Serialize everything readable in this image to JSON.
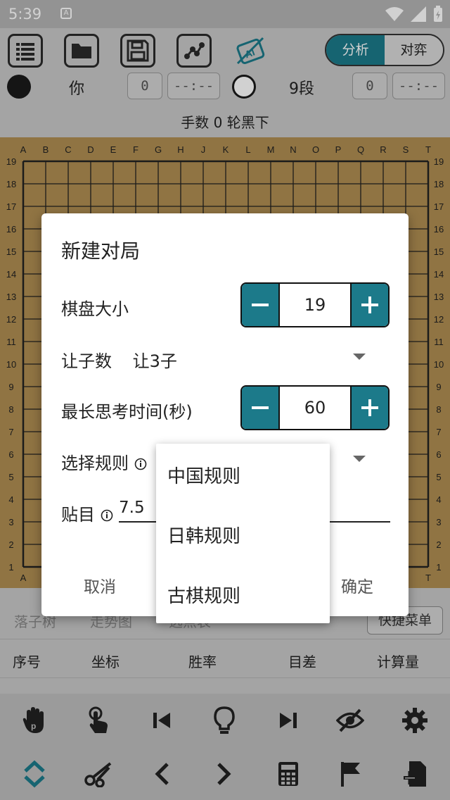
{
  "status": {
    "time": "5:39",
    "app_badge": "A"
  },
  "toolbar": {
    "icons": [
      "list-icon",
      "folder-icon",
      "save-icon",
      "graph-icon",
      "ai-off-icon"
    ],
    "mode_tabs": [
      {
        "label": "分析",
        "active": true
      },
      {
        "label": "对弈",
        "active": false
      }
    ]
  },
  "players": {
    "black": {
      "name": "你",
      "captures": "0",
      "time": "--:--"
    },
    "white": {
      "name": "9段",
      "captures": "0",
      "time": "--:--"
    }
  },
  "move_info": "手数 0  轮黑下",
  "board": {
    "columns": [
      "A",
      "B",
      "C",
      "D",
      "E",
      "F",
      "G",
      "H",
      "J",
      "K",
      "L",
      "M",
      "N",
      "O",
      "P",
      "Q",
      "R",
      "S",
      "T"
    ],
    "rows": [
      "19",
      "18",
      "17",
      "16",
      "15",
      "14",
      "13",
      "12",
      "11",
      "10",
      "9",
      "8",
      "7",
      "6",
      "5",
      "4",
      "3",
      "2",
      "1"
    ],
    "bg": "#b08e52"
  },
  "dialog": {
    "title": "新建对局",
    "board_size": {
      "label": "棋盘大小",
      "value": "19"
    },
    "handicap": {
      "label": "让子数",
      "value": "让3子"
    },
    "max_think": {
      "label": "最长思考时间(秒)",
      "value": "60"
    },
    "rules": {
      "label": "选择规则"
    },
    "komi": {
      "label": "贴目",
      "value": "7.5"
    },
    "cancel": "取消",
    "confirm": "确定"
  },
  "rules_popup": {
    "options": [
      "中国规则",
      "日韩规则",
      "古棋规则"
    ]
  },
  "tabs": {
    "items": [
      "落子树",
      "走势图",
      "选点表"
    ],
    "quick_menu": "快捷菜单"
  },
  "table_headers": [
    "序号",
    "坐标",
    "胜率",
    "目差",
    "计算量"
  ],
  "bottom_icons": {
    "row1": [
      "hand-icon",
      "tap-icon",
      "first-move-icon",
      "hint-bulb-icon",
      "last-move-icon",
      "hide-icon",
      "settings-gear-icon"
    ],
    "row2": [
      "expand-collapse-icon",
      "cut-icon",
      "prev-icon",
      "next-icon",
      "calculator-icon",
      "flag-icon",
      "add-file-icon"
    ]
  },
  "colors": {
    "accent": "#1c7a8a",
    "board": "#b08e52"
  }
}
